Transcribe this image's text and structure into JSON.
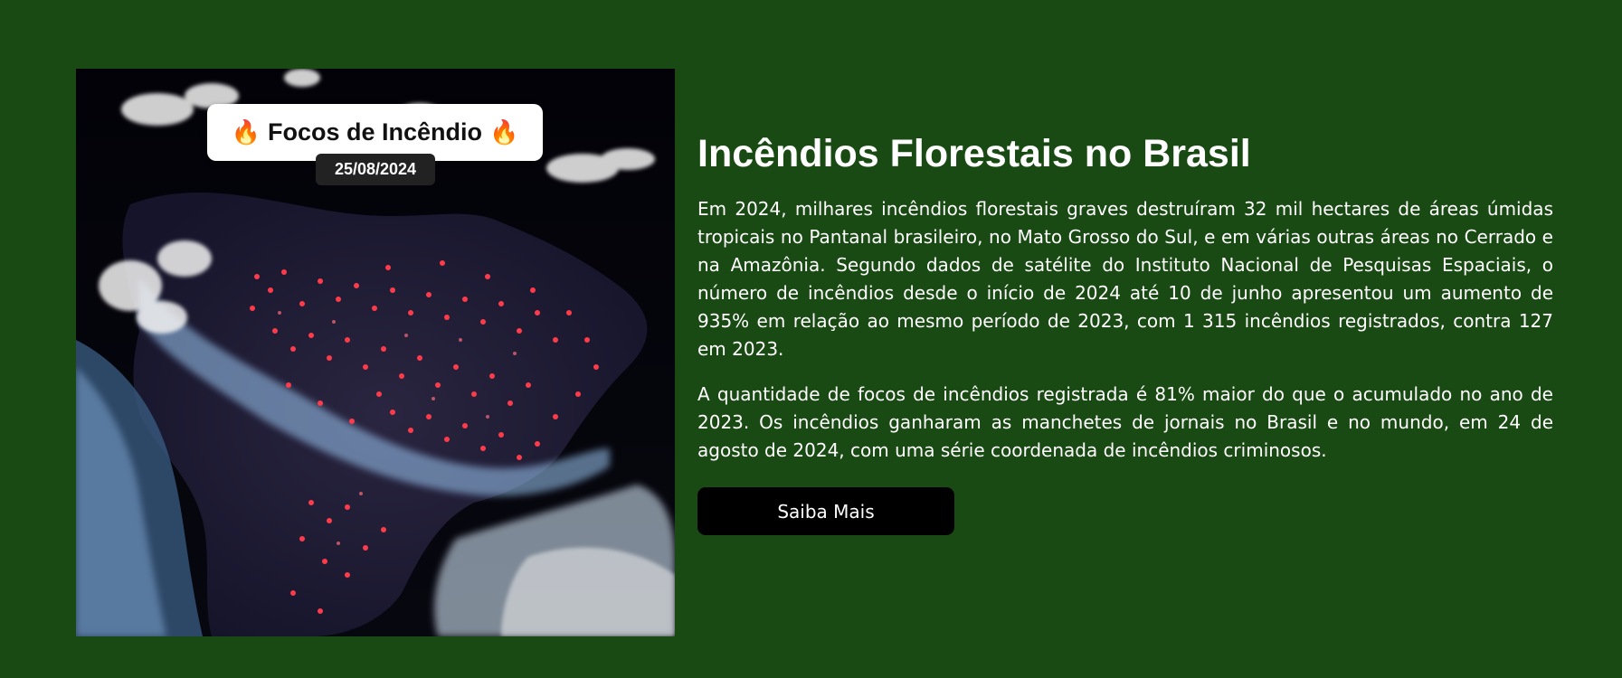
{
  "image": {
    "icon": "fire-emoji",
    "caption_title": "Focos de Incêndio",
    "date": "25/08/2024"
  },
  "main": {
    "title": "Incêndios Florestais no Brasil",
    "paragraphs": [
      "Em 2024, milhares incêndios florestais graves destruíram 32 mil hectares de áreas úmidas tropicais no Pantanal brasileiro, no Mato Grosso do Sul, e em várias outras áreas no Cerrado e na Amazônia. Segundo dados de satélite do Instituto Nacional de Pesquisas Espaciais, o número de incêndios desde o início de 2024 até 10 de junho apresentou um aumento de 935% em relação ao mesmo período de 2023, com 1 315 incêndios registrados, contra 127 em 2023.",
      "A quantidade de focos de incêndios registrada é 81% maior do que o acumulado no ano de 2023. Os incêndios ganharam as manchetes de jornais no Brasil e no mundo, em 24 de agosto de 2024, com uma série coordenada de incêndios criminosos."
    ],
    "button_label": "Saiba Mais"
  },
  "colors": {
    "background": "#1a4a13",
    "button": "#000000",
    "fire_dots": "#ff3b4a"
  }
}
